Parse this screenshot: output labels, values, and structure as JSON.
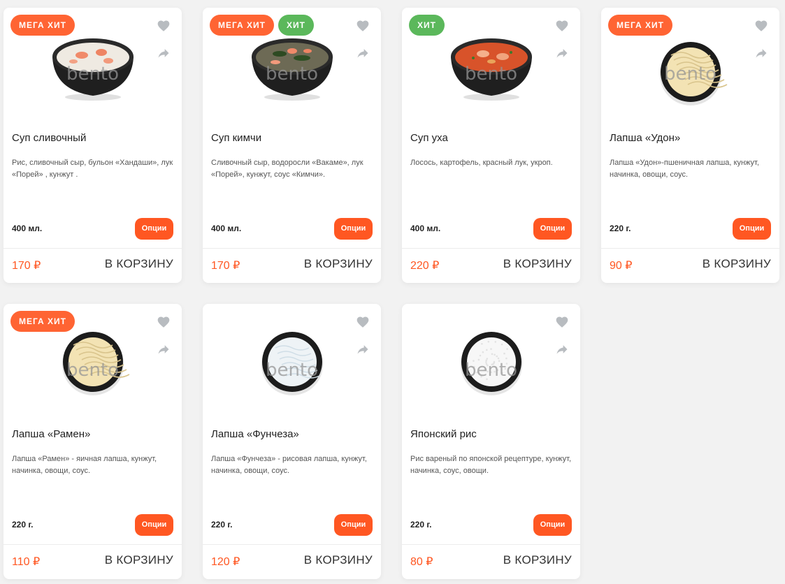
{
  "colors": {
    "accent": "#ff5722",
    "badge_mega": "#ff6433",
    "badge_hit": "#5bb85b",
    "icon": "#b8bcc0",
    "background": "#f2f2f2"
  },
  "icons": {
    "favorite": "heart-icon",
    "share": "share-arrow-icon"
  },
  "watermark": "bento",
  "products": [
    {
      "name": "Суп сливочный",
      "description": "Рис, сливочный сыр, бульон «Хандаши», лук «Порей» , кунжут .",
      "weight": "400 мл.",
      "price": "170 ₽",
      "options_label": "Опции",
      "cart_label": "В КОРЗИНУ",
      "badges": [
        {
          "label": "МЕГА ХИТ",
          "type": "mega"
        }
      ],
      "dish": "soup-creamy"
    },
    {
      "name": "Суп кимчи",
      "description": "Сливочный сыр, водоросли «Вакаме», лук «Порей», кунжут, соус «Кимчи».",
      "weight": "400 мл.",
      "price": "170 ₽",
      "options_label": "Опции",
      "cart_label": "В КОРЗИНУ",
      "badges": [
        {
          "label": "МЕГА ХИТ",
          "type": "mega"
        },
        {
          "label": "ХИТ",
          "type": "hit"
        }
      ],
      "dish": "soup-kimchi"
    },
    {
      "name": "Суп уха",
      "description": "Лосось, картофель, красный лук, укроп.",
      "weight": "400 мл.",
      "price": "220 ₽",
      "options_label": "Опции",
      "cart_label": "В КОРЗИНУ",
      "badges": [
        {
          "label": "ХИТ",
          "type": "hit"
        }
      ],
      "dish": "soup-ukha"
    },
    {
      "name": "Лапша «Удон»",
      "description": "Лапша «Удон»-пшеничная лапша, кунжут, начинка, овощи, соус.",
      "weight": "220 г.",
      "price": "90 ₽",
      "options_label": "Опции",
      "cart_label": "В КОРЗИНУ",
      "badges": [
        {
          "label": "МЕГА ХИТ",
          "type": "mega"
        }
      ],
      "dish": "noodles-udon"
    },
    {
      "name": "Лапша «Рамен»",
      "description": "Лапша «Рамен» - яичная лапша, кунжут, начинка, овощи, соус.",
      "weight": "220 г.",
      "price": "110 ₽",
      "options_label": "Опции",
      "cart_label": "В КОРЗИНУ",
      "badges": [
        {
          "label": "МЕГА ХИТ",
          "type": "mega"
        }
      ],
      "dish": "noodles-ramen"
    },
    {
      "name": "Лапша «Фунчеза»",
      "description": "Лапша «Фунчеза» - рисовая лапша, кунжут, начинка, овощи, соус.",
      "weight": "220 г.",
      "price": "120 ₽",
      "options_label": "Опции",
      "cart_label": "В КОРЗИНУ",
      "badges": [],
      "dish": "noodles-funchoza"
    },
    {
      "name": "Японский рис",
      "description": "Рис вареный по японской рецептуре, кунжут, начинка, соус, овощи.",
      "weight": "220 г.",
      "price": "80 ₽",
      "options_label": "Опции",
      "cart_label": "В КОРЗИНУ",
      "badges": [],
      "dish": "rice-japanese"
    }
  ]
}
